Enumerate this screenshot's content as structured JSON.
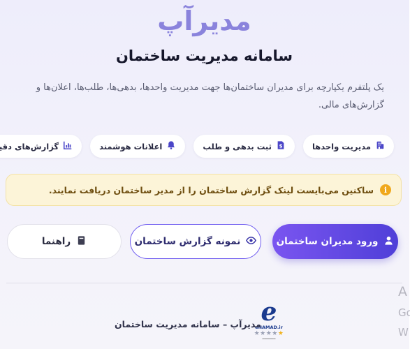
{
  "header": {
    "brand": "مدیرآپ",
    "subtitle": "سامانه مدیریت ساختمان",
    "description": "یک پلتفرم یکپارچه برای مدیران ساختمان‌ها جهت مدیریت واحدها، بدهی‌ها، طلب‌ها، اعلان‌ها و گزارش‌های مالی."
  },
  "features": [
    {
      "label": "مدیریت واحدها",
      "icon": "building-icon"
    },
    {
      "label": "ثبت بدهی و طلب",
      "icon": "invoice-icon"
    },
    {
      "label": "اعلانات هوشمند",
      "icon": "bell-icon"
    },
    {
      "label": "گزارش‌های دقیق",
      "icon": "chart-icon"
    }
  ],
  "notice": {
    "text": "ساکنین می‌بایست لینک گزارش ساختمان را از مدیر ساختمان دریافت نمایند.",
    "icon": "info-icon"
  },
  "actions": {
    "login": {
      "label": "ورود مدیران ساختمان",
      "icon": "user-icon"
    },
    "sample": {
      "label": "نمونه گزارش ساختمان",
      "icon": "eye-icon"
    },
    "guide": {
      "label": "راهنما",
      "icon": "book-icon"
    }
  },
  "footer": {
    "text": "مدیرآپ – سامانه مدیریت ساختمان",
    "badge_name": "eNAMAD.ir",
    "badge_stars": 1,
    "badge_stars_total": 5
  },
  "overlay": {
    "line1": "A",
    "line2": "Go",
    "line3": "W"
  },
  "colors": {
    "brand": "#8a83dc",
    "primary": "#5b45e0",
    "notice_bg": "#fcf4d8",
    "notice_icon": "#f0a81c"
  }
}
